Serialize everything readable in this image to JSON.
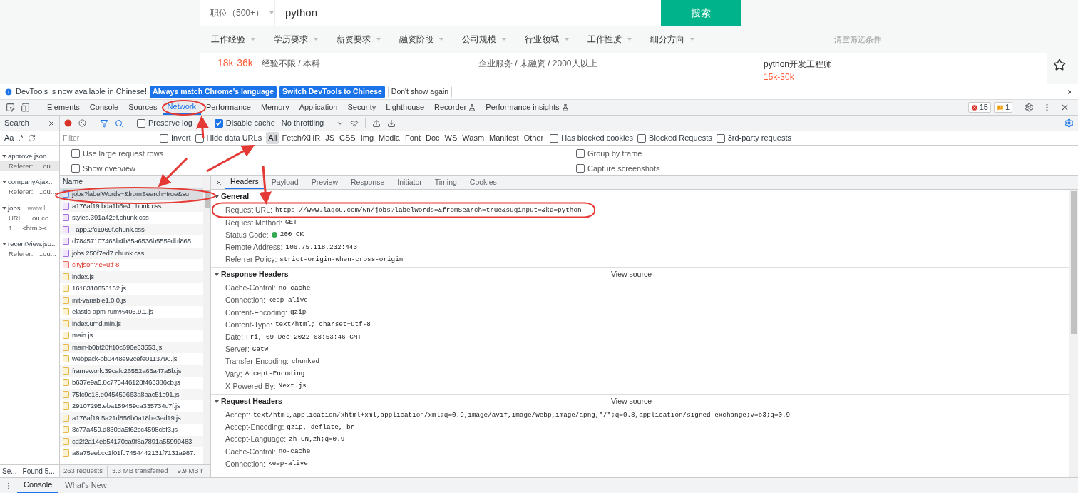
{
  "web_page": {
    "search": {
      "category": "职位（500+）",
      "query": "python",
      "button": "搜索"
    },
    "filters": [
      "工作经验",
      "学历要求",
      "薪资要求",
      "融资阶段",
      "公司规模",
      "行业领域",
      "工作性质",
      "细分方向"
    ],
    "clear": "清空筛选条件",
    "job": {
      "salary": "18k-36k",
      "requirements": "经验不限 / 本科",
      "company": "企业服务 / 未融资 / 2000人以上"
    },
    "side_job": {
      "title": "python开发工程师",
      "salary": "15k-30k"
    }
  },
  "infobar": {
    "message": "DevTools is now available in Chinese!",
    "buttons": [
      "Always match Chrome's language",
      "Switch DevTools to Chinese",
      "Don't show again"
    ]
  },
  "tabs": [
    {
      "label": "Elements",
      "selected": false,
      "experimental": false
    },
    {
      "label": "Console",
      "selected": false,
      "experimental": false
    },
    {
      "label": "Sources",
      "selected": false,
      "experimental": false
    },
    {
      "label": "Network",
      "selected": true,
      "experimental": false
    },
    {
      "label": "Performance",
      "selected": false,
      "experimental": false
    },
    {
      "label": "Memory",
      "selected": false,
      "experimental": false
    },
    {
      "label": "Application",
      "selected": false,
      "experimental": false
    },
    {
      "label": "Security",
      "selected": false,
      "experimental": false
    },
    {
      "label": "Lighthouse",
      "selected": false,
      "experimental": false
    },
    {
      "label": "Recorder",
      "selected": false,
      "experimental": true
    },
    {
      "label": "Performance insights",
      "selected": false,
      "experimental": true
    }
  ],
  "issues": {
    "errors": "15",
    "warnings": "1"
  },
  "search_panel": {
    "title": "Search",
    "case_toggle": "Aa",
    "regex_toggle": ".*",
    "results": [
      {
        "file": "approve.json...",
        "lines": [
          {
            "label": "Referer:",
            "text": "...ou..."
          }
        ]
      },
      {
        "file": "companyAjax...",
        "lines": [
          {
            "label": "Referer:",
            "text": "...ou..."
          }
        ]
      },
      {
        "file": "jobs",
        "source": "www.l...",
        "lines": [
          {
            "label": "URL",
            "text": "...ou.co..."
          },
          {
            "label": "1",
            "text": "...<html><..."
          }
        ]
      },
      {
        "file": "recentView.jso...",
        "lines": [
          {
            "label": "Referer:",
            "text": "...ou..."
          }
        ]
      }
    ],
    "status": [
      "Se...",
      "Found 5..."
    ]
  },
  "network_toolbar": {
    "preserve_log": {
      "label": "Preserve log",
      "checked": false
    },
    "disable_cache": {
      "label": "Disable cache",
      "checked": true
    },
    "throttling": "No throttling"
  },
  "filter": {
    "placeholder": "Filter",
    "checks": [
      {
        "label": "Invert",
        "checked": false
      },
      {
        "label": "Hide data URLs",
        "checked": false
      }
    ],
    "types": [
      {
        "label": "All",
        "selected": true
      },
      {
        "label": "Fetch/XHR",
        "selected": false
      },
      {
        "label": "JS",
        "selected": false
      },
      {
        "label": "CSS",
        "selected": false
      },
      {
        "label": "Img",
        "selected": false
      },
      {
        "label": "Media",
        "selected": false
      },
      {
        "label": "Font",
        "selected": false
      },
      {
        "label": "Doc",
        "selected": false
      },
      {
        "label": "WS",
        "selected": false
      },
      {
        "label": "Wasm",
        "selected": false
      },
      {
        "label": "Manifest",
        "selected": false
      },
      {
        "label": "Other",
        "selected": false
      }
    ],
    "checks_after": [
      {
        "label": "Has blocked cookies",
        "checked": false
      },
      {
        "label": "Blocked Requests",
        "checked": false
      },
      {
        "label": "3rd-party requests",
        "checked": false
      }
    ]
  },
  "options_left": [
    {
      "label": "Use large request rows",
      "checked": false
    },
    {
      "label": "Show overview",
      "checked": false
    }
  ],
  "options_right": [
    {
      "label": "Group by frame",
      "checked": false
    },
    {
      "label": "Capture screenshots",
      "checked": false
    }
  ],
  "requests": {
    "column": "Name",
    "rows": [
      {
        "name": "jobs?labelWords=&fromSearch=true&su",
        "kind": "doc",
        "selected": true
      },
      {
        "name": "a176af19.bda1b6e4.chunk.css",
        "kind": "css",
        "selected": false
      },
      {
        "name": "styles.391a42ef.chunk.css",
        "kind": "css",
        "selected": false
      },
      {
        "name": "_app.2fc1969f.chunk.css",
        "kind": "css",
        "selected": false
      },
      {
        "name": "d78457107465b4b85a6536b5559dbf865",
        "kind": "css",
        "selected": false
      },
      {
        "name": "jobs.250f7ed7.chunk.css",
        "kind": "css",
        "selected": false
      },
      {
        "name": "cityjson?ie=utf-8",
        "kind": "error",
        "selected": false
      },
      {
        "name": "index.js",
        "kind": "js",
        "selected": false
      },
      {
        "name": "1618310653162.js",
        "kind": "js",
        "selected": false
      },
      {
        "name": "init-variable1.0.0.js",
        "kind": "js",
        "selected": false
      },
      {
        "name": "elastic-apm-rum%405.9.1.js",
        "kind": "js",
        "selected": false
      },
      {
        "name": "index.umd.min.js",
        "kind": "js",
        "selected": false
      },
      {
        "name": "main.js",
        "kind": "js",
        "selected": false
      },
      {
        "name": "main-b0bf28ff10c696e33553.js",
        "kind": "js",
        "selected": false
      },
      {
        "name": "webpack-bb0448e92cefe0113790.js",
        "kind": "js",
        "selected": false
      },
      {
        "name": "framework.39cafc26552a66a47a5b.js",
        "kind": "js",
        "selected": false
      },
      {
        "name": "b637e9a5.8c775446128f463386cb.js",
        "kind": "js",
        "selected": false
      },
      {
        "name": "75fc9c18.e045459663a8bac51c91.js",
        "kind": "js",
        "selected": false
      },
      {
        "name": "29107295.eba159459ca335734c7f.js",
        "kind": "js",
        "selected": false
      },
      {
        "name": "a176af19.5a21d856b0a18be3ed19.js",
        "kind": "js",
        "selected": false
      },
      {
        "name": "8c77a459.d830da5f62cc4598cbf3.js",
        "kind": "js",
        "selected": false
      },
      {
        "name": "cd2f2a14eb54170ca9f8a7891a55999483",
        "kind": "js",
        "selected": false
      },
      {
        "name": "a8a75eebcc1f01fc7454442131f7131a987.",
        "kind": "js",
        "selected": false
      }
    ],
    "summary": [
      "263 requests",
      "3.3 MB transferred",
      "9.9 MB r"
    ]
  },
  "details": {
    "tabs": [
      {
        "label": "Headers",
        "selected": true
      },
      {
        "label": "Payload",
        "selected": false
      },
      {
        "label": "Preview",
        "selected": false
      },
      {
        "label": "Response",
        "selected": false
      },
      {
        "label": "Initiator",
        "selected": false
      },
      {
        "label": "Timing",
        "selected": false
      },
      {
        "label": "Cookies",
        "selected": false
      }
    ],
    "sections": [
      {
        "title": "General",
        "rows": [
          {
            "name": "Request URL:",
            "value": "https://www.lagou.com/wn/jobs?labelWords=&fromSearch=true&suginput=&kd=python",
            "kind": "plain"
          },
          {
            "name": "Request Method:",
            "value": "GET",
            "kind": "plain"
          },
          {
            "name": "Status Code:",
            "value": "200 OK",
            "kind": "status"
          },
          {
            "name": "Remote Address:",
            "value": "106.75.118.232:443",
            "kind": "plain"
          },
          {
            "name": "Referrer Policy:",
            "value": "strict-origin-when-cross-origin",
            "kind": "plain"
          }
        ]
      },
      {
        "title": "Response Headers",
        "view_source": "View source",
        "rows": [
          {
            "name": "Cache-Control:",
            "value": "no-cache",
            "kind": "plain"
          },
          {
            "name": "Connection:",
            "value": "keep-alive",
            "kind": "plain"
          },
          {
            "name": "Content-Encoding:",
            "value": "gzip",
            "kind": "plain"
          },
          {
            "name": "Content-Type:",
            "value": "text/html; charset=utf-8",
            "kind": "plain"
          },
          {
            "name": "Date:",
            "value": "Fri, 09 Dec 2022 03:53:46 GMT",
            "kind": "plain"
          },
          {
            "name": "Server:",
            "value": "GatW",
            "kind": "plain"
          },
          {
            "name": "Transfer-Encoding:",
            "value": "chunked",
            "kind": "plain"
          },
          {
            "name": "Vary:",
            "value": "Accept-Encoding",
            "kind": "plain"
          },
          {
            "name": "X-Powered-By:",
            "value": "Next.js",
            "kind": "plain"
          }
        ]
      },
      {
        "title": "Request Headers",
        "view_source": "View source",
        "rows": [
          {
            "name": "Accept:",
            "value": "text/html,application/xhtml+xml,application/xml;q=0.9,image/avif,image/webp,image/apng,*/*;q=0.8,application/signed-exchange;v=b3;q=0.9",
            "kind": "plain"
          },
          {
            "name": "Accept-Encoding:",
            "value": "gzip, deflate, br",
            "kind": "plain"
          },
          {
            "name": "Accept-Language:",
            "value": "zh-CN,zh;q=0.9",
            "kind": "plain"
          },
          {
            "name": "Cache-Control:",
            "value": "no-cache",
            "kind": "plain"
          },
          {
            "name": "Connection:",
            "value": "keep-alive",
            "kind": "plain"
          }
        ]
      }
    ]
  },
  "drawer": {
    "tabs": [
      {
        "label": "Console",
        "selected": true
      },
      {
        "label": "What's New",
        "selected": false
      }
    ]
  }
}
